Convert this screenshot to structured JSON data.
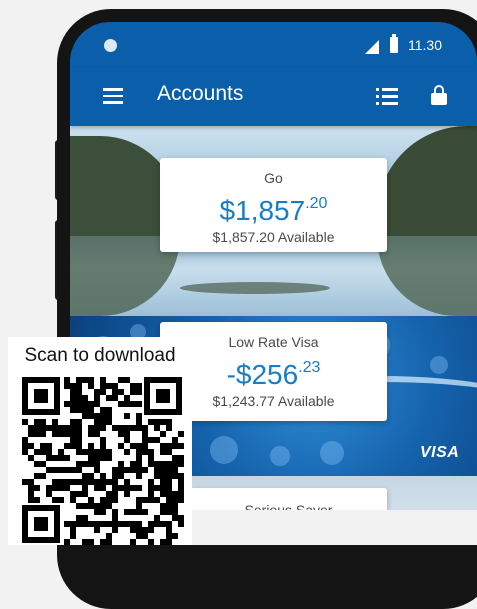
{
  "status_bar": {
    "time": "11.30"
  },
  "app_bar": {
    "title": "Accounts"
  },
  "accounts": [
    {
      "name": "Go",
      "amount_main": "$1,857",
      "amount_cents": ".20",
      "available": "$1,857.20 Available"
    },
    {
      "name": "Low Rate Visa",
      "amount_main": "-$256",
      "amount_cents": ".23",
      "available": "$1,243.77 Available"
    },
    {
      "name": "Serious Saver"
    }
  ],
  "card_brand": "VISA",
  "qr": {
    "caption": "Scan to download"
  },
  "icons": {
    "menu": "menu-icon",
    "list": "list-icon",
    "lock": "lock-icon",
    "signal": "signal-icon",
    "battery": "battery-icon",
    "qr": "qr-code-icon"
  },
  "colors": {
    "primary": "#0b5faa",
    "amount": "#1a7dc4"
  }
}
